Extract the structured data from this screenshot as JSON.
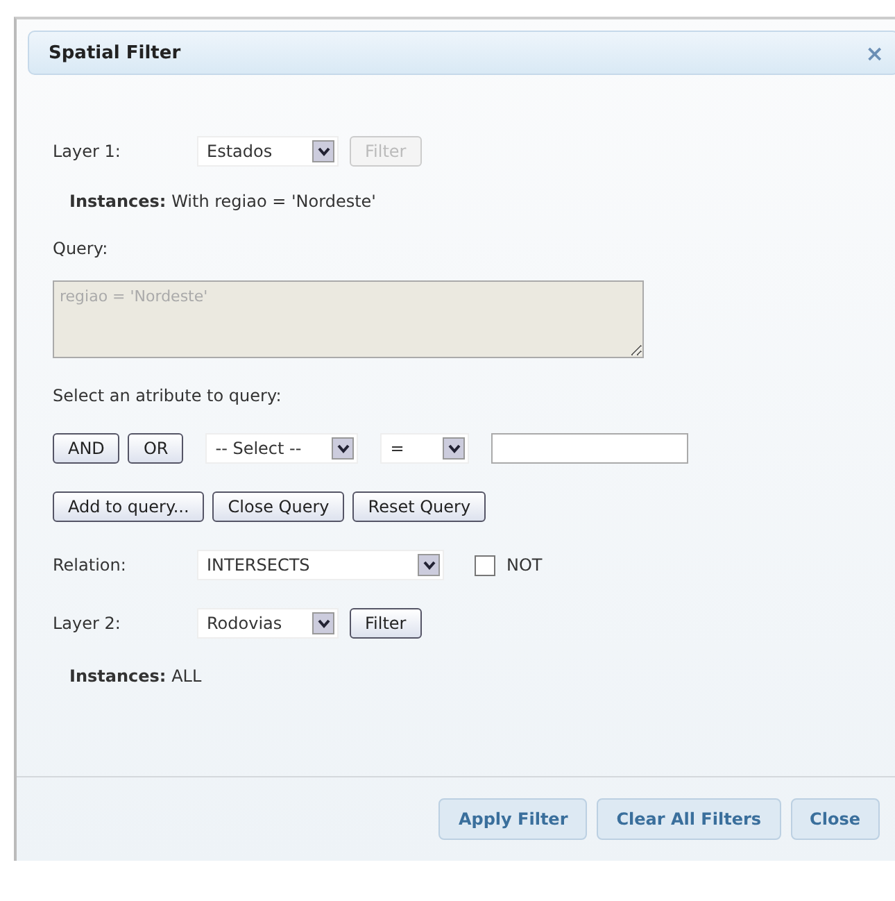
{
  "window": {
    "title": "Spatial Filter",
    "close": "×"
  },
  "layer1": {
    "label": "Layer 1:",
    "select": "Estados",
    "filter_button": {
      "label": "Filter",
      "disabled": true
    },
    "instances_label": "Instances:",
    "instances_value": "With regiao = 'Nordeste'"
  },
  "query": {
    "label": "Query:",
    "value": "regiao = 'Nordeste'"
  },
  "attribute": {
    "label": "Select an atribute to query:",
    "logic_buttons": [
      "AND",
      "OR"
    ],
    "attribute_select": "-- Select --",
    "operator_select": "="
  },
  "query_buttons": [
    "Add to query...",
    "Close Query",
    "Reset Query"
  ],
  "relation": {
    "label": "Relation:",
    "select": "INTERSECTS",
    "not_label": "NOT",
    "not_checked": false
  },
  "layer2": {
    "label": "Layer 2:",
    "select": "Rodovias",
    "filter_button": {
      "label": "Filter",
      "disabled": false
    },
    "instances_label": "Instances:",
    "instances_value": "ALL"
  },
  "footer_buttons": [
    "Apply Filter",
    "Clear All Filters",
    "Close"
  ]
}
